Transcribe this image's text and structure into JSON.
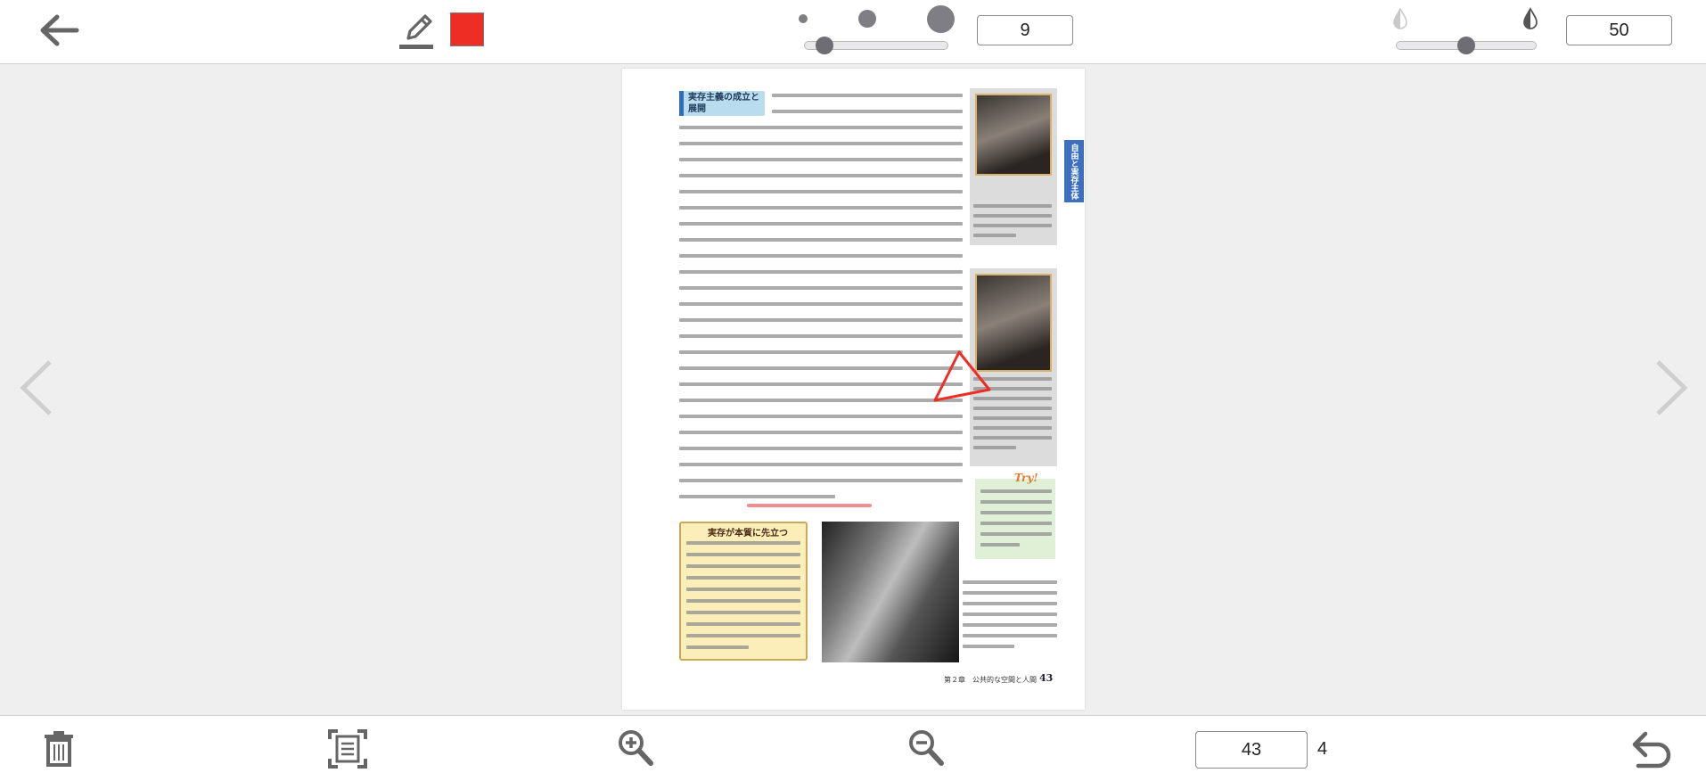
{
  "toolbar": {
    "pen_color": "#ee2d24",
    "pen_size_value": "9",
    "opacity_value": "50",
    "pen_size_level": 0.09,
    "opacity_level": 0.5
  },
  "viewer": {
    "current_page": "43",
    "total_pages": "4"
  },
  "document": {
    "page_number_label": "43",
    "footer": "第２章　公共的な空間と人間",
    "side_tab": "自由と実存主体",
    "try_label": "Try!",
    "heading": "実存主義の成立と展開",
    "quote_title": "実存が本質に先立つ"
  },
  "icons": {
    "back": "arrow-left-icon",
    "pen": "pen-icon",
    "prev": "chevron-left-icon",
    "next": "chevron-right-icon",
    "delete": "trash-icon",
    "fit": "fit-page-icon",
    "zoom_in": "zoom-in-icon",
    "zoom_out": "zoom-out-icon",
    "undo": "undo-icon"
  }
}
